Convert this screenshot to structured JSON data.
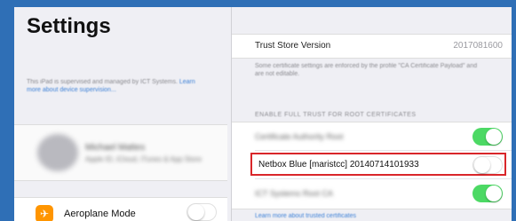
{
  "left": {
    "title": "Settings",
    "supervision_text": "This iPad is supervised and managed by ICT Systems.",
    "supervision_link": "Learn more about device supervision...",
    "profile_name": "Michael Mattes",
    "profile_sub": "Apple ID, iCloud, iTunes & App Store",
    "airplane_label": "Aeroplane Mode",
    "airplane_state": "off",
    "airplane_icon_color": "#ff9500"
  },
  "right": {
    "trust_store_label": "Trust Store Version",
    "trust_store_value": "2017081600",
    "note": "Some certificate settings are enforced by the profile \"CA Certificate Payload\" and are not editable.",
    "section_header": "ENABLE FULL TRUST FOR ROOT CERTIFICATES",
    "certs": [
      {
        "label": "Certificate Authority Root",
        "state": "on",
        "blurred": true
      },
      {
        "label": "Netbox Blue [maristcc] 20140714101933",
        "state": "off",
        "blurred": false,
        "highlighted": true
      },
      {
        "label": "ICT Systems Root CA",
        "state": "on",
        "blurred": true
      }
    ],
    "footer_link": "Learn more about trusted certificates"
  },
  "colors": {
    "toggle_on": "#4cd964",
    "highlight": "#d9262a",
    "link": "#3a7fd6"
  }
}
